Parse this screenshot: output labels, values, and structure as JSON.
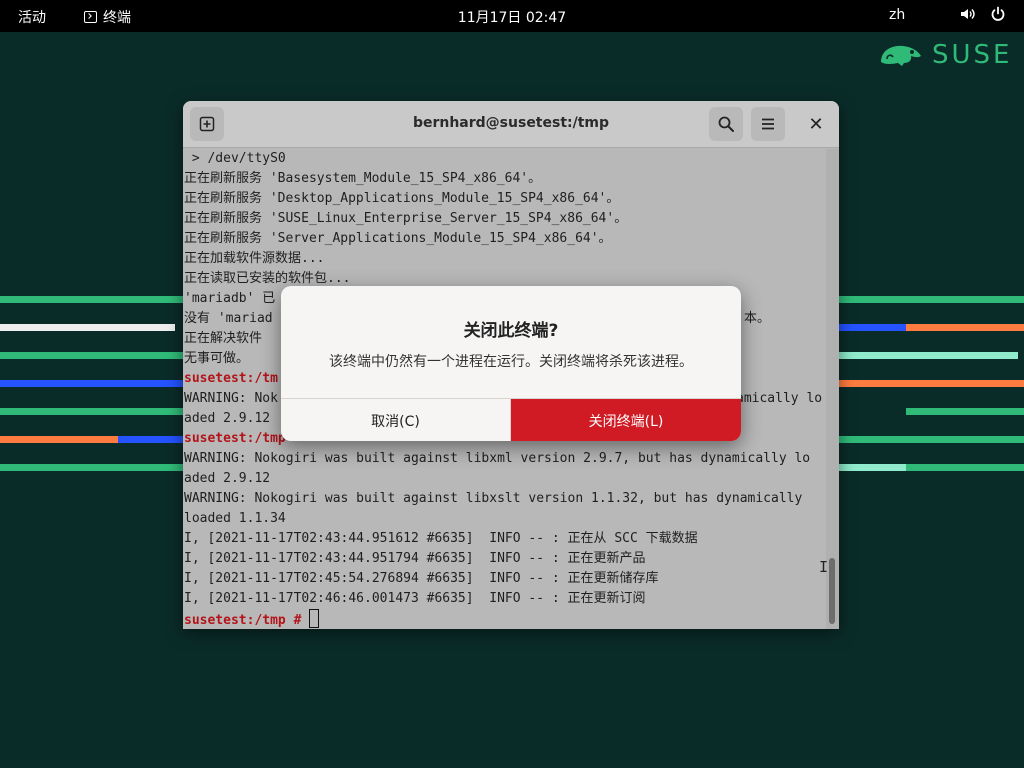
{
  "topbar": {
    "activities": "活动",
    "app_name": "终端",
    "clock": "11月17日 02:47",
    "language": "zh"
  },
  "brand": {
    "logo_text": "SUSE",
    "color": "#30ba78"
  },
  "terminal_window": {
    "title": "bernhard@susetest:/tmp",
    "lines": [
      " > /dev/ttyS0",
      "正在刷新服务 'Basesystem_Module_15_SP4_x86_64'。",
      "正在刷新服务 'Desktop_Applications_Module_15_SP4_x86_64'。",
      "正在刷新服务 'SUSE_Linux_Enterprise_Server_15_SP4_x86_64'。",
      "正在刷新服务 'Server_Applications_Module_15_SP4_x86_64'。",
      "正在加载软件源数据...",
      "正在读取已安装的软件包..."
    ],
    "partial": {
      "l8": "'mariadb' 已",
      "l9a": "没有 'mariad",
      "l9b": "本。",
      "l10": "正在解决软件",
      "l11": "无事可做。",
      "l12_prompt": "susetest:/tm",
      "l13a": "WARNING: Nok",
      "l13b": "amically lo",
      "l14": "aded 2.9.12",
      "l15_prompt": "susetest:/tmp"
    },
    "tail_lines": [
      "WARNING: Nokogiri was built against libxml version 2.9.7, but has dynamically lo",
      "aded 2.9.12",
      "WARNING: Nokogiri was built against libxslt version 1.1.32, but has dynamically",
      "loaded 1.1.34",
      "I, [2021-11-17T02:43:44.951612 #6635]  INFO -- : 正在从 SCC 下载数据",
      "I, [2021-11-17T02:43:44.951794 #6635]  INFO -- : 正在更新产品",
      "I, [2021-11-17T02:45:54.276894 #6635]  INFO -- : 正在更新储存库",
      "I, [2021-11-17T02:46:46.001473 #6635]  INFO -- : 正在更新订阅"
    ],
    "final_prompt": "susetest:/tmp #"
  },
  "dialog": {
    "title": "关闭此终端?",
    "message": "该终端中仍然有一个进程在运行。关闭终端将杀死该进程。",
    "cancel_label": "取消(C)",
    "confirm_label": "关闭终端(L)",
    "confirm_color": "#d01b24"
  }
}
